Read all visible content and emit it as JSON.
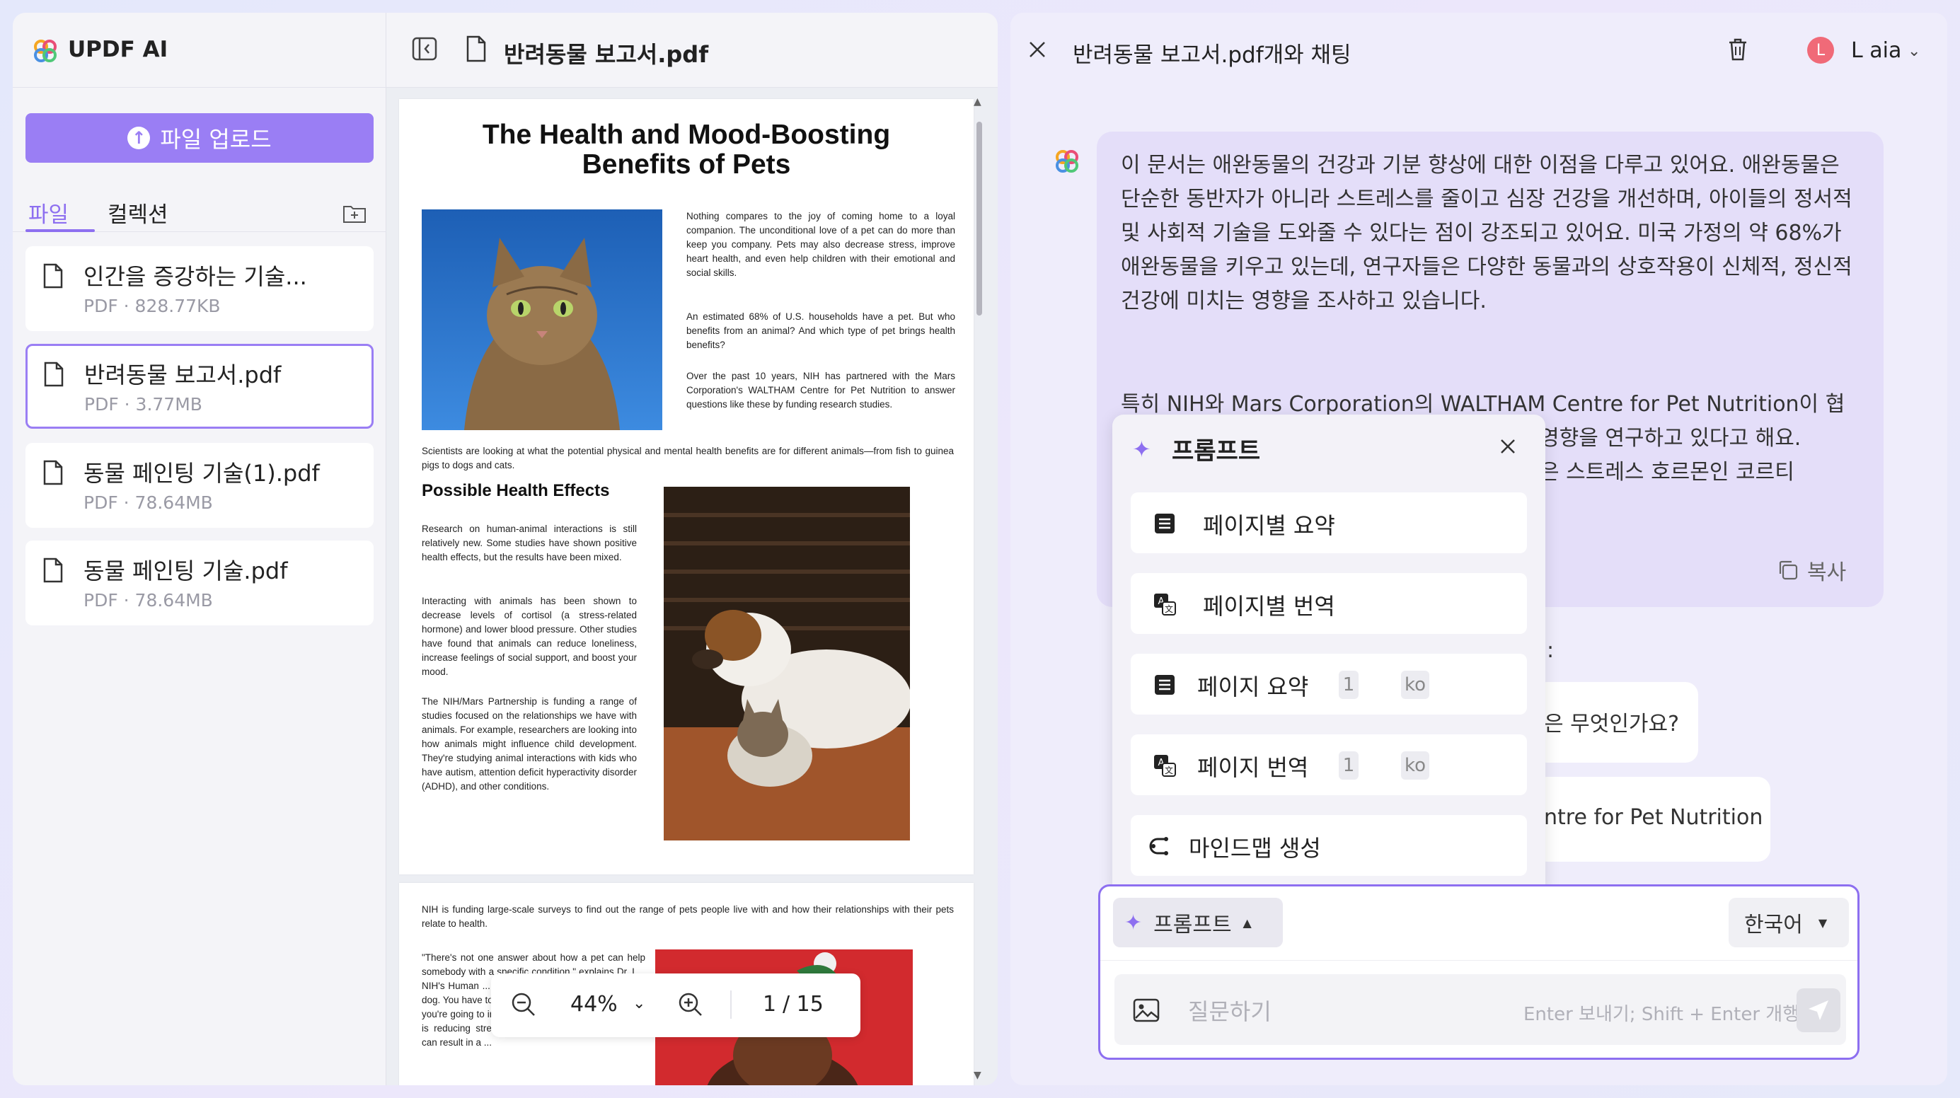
{
  "app": {
    "title": "UPDF AI"
  },
  "sidebar": {
    "upload_label": "파일 업로드",
    "tabs": [
      {
        "label": "파일"
      },
      {
        "label": "컬렉션"
      }
    ],
    "files": [
      {
        "name": "인간을 증강하는 기술...",
        "meta": "PDF · 828.77KB"
      },
      {
        "name": "반려동물 보고서.pdf",
        "meta": "PDF · 3.77MB"
      },
      {
        "name": "동물 페인팅 기술(1).pdf",
        "meta": "PDF · 78.64MB"
      },
      {
        "name": "동물 페인팅 기술.pdf",
        "meta": "PDF · 78.64MB"
      }
    ]
  },
  "viewer": {
    "doc_title": "반려동물 보고서.pdf",
    "page1": {
      "title": "The Health and Mood-Boosting Benefits of Pets",
      "intro": "Nothing compares to the joy of coming home to a loyal companion. The unconditional love of a pet can do more than keep you company. Pets may also decrease stress, improve heart health, and even help children with their emotional and social skills.",
      "households": "An estimated 68% of U.S. households have a pet. But who benefits from an animal? And which type of pet brings health benefits?",
      "partnership": "Over the past 10 years, NIH has partnered with the Mars Corporation's WALTHAM Centre for Pet Nutrition to answer questions like these by funding research studies.",
      "scientists": "Scientists are looking at what the potential physical and mental health benefits are for different animals—from fish to guinea pigs to dogs and cats.",
      "subheading": "Possible Health Effects",
      "research": "Research on human-animal interactions is still relatively new. Some studies have shown positive health effects, but the results have been mixed.",
      "interacting": "Interacting with animals has been shown to decrease levels of cortisol (a stress-related hormone) and lower blood pressure. Other studies have found that animals can reduce loneliness, increase feelings of social support, and boost your mood.",
      "nih_mars": "The NIH/Mars Partnership is funding a range of studies focused on the relationships we have with animals. For example, researchers are looking into how animals might influence child development. They're studying animal interactions with kids who have autism, attention deficit hyperactivity disorder (ADHD), and other conditions."
    },
    "page2": {
      "surveys": "NIH is funding large-scale surveys to find out the range of pets people live with and how their relationships with their pets relate to health.",
      "quote": "\"There's not one answer about how a pet can help somebody with a specific condition,\" explains Dr. L... NIH's Human ... Program. \"Is y... activity? Then ... a dog. You have to walk a dog several times a day and you're going to increase physical activity. If your goal is reducing stress, sometimes watching fish swim can result in a ..."
    },
    "zoom": {
      "level": "44%",
      "page_current": "1",
      "page_total": "/ 15"
    }
  },
  "chat": {
    "title": "반려동물 보고서.pdf개와 채팅",
    "user": {
      "initial": "L",
      "name": "L aia"
    },
    "ai_message": {
      "para1": "이 문서는 애완동물의 건강과 기분 향상에 대한 이점을 다루고 있어요. 애완동물은 단순한 동반자가 아니라 스트레스를 줄이고 심장 건강을 개선하며, 아이들의 정서적 및 사회적 기술을 도와줄 수 있다는 점이 강조되고 있어요. 미국 가정의 약 68%가 애완동물을 키우고 있는데, 연구자들은 다양한 동물과의 상호작용이 신체적, 정신적 건강에 미치는 영향을 조사하고 있습니다.",
      "para2_line1": "특히 NIH와 Mars Corporation의 WALTHAM Centre for Pet Nutrition이 협",
      "para2_line2": "영향을 연구하고 있다고 해요.",
      "para2_line3": "은 스트레스 호르몬인 코르티",
      "copy_label": "복사"
    },
    "partial_colon": ":",
    "partial_question": "은 무엇인가요?",
    "partial_waltham": "ntre for Pet Nutrition",
    "prompt_menu": {
      "title": "프롬프트",
      "items": [
        {
          "label": "페이지별 요약",
          "icon": "list-icon"
        },
        {
          "label": "페이지별 번역",
          "icon": "translate-icon"
        },
        {
          "label": "페이지 요약",
          "icon": "list-icon",
          "page": "1",
          "lang": "ko"
        },
        {
          "label": "페이지 번역",
          "icon": "translate-icon",
          "page": "1",
          "lang": "ko"
        },
        {
          "label": "마인드맵 생성",
          "icon": "mindmap-icon"
        }
      ]
    },
    "input": {
      "prompt_label": "프롬프트",
      "language": "한국어",
      "placeholder": "질문하기",
      "hint": "Enter 보내기; Shift + Enter 개행"
    }
  },
  "colors": {
    "accent": "#9a7ef4",
    "avatar": "#f06a78"
  }
}
